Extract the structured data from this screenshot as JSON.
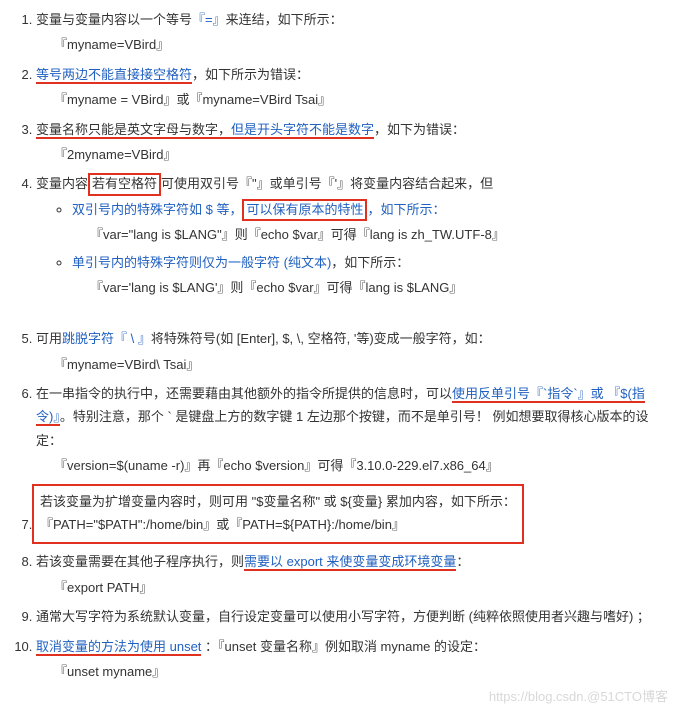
{
  "items": {
    "i1": {
      "pre": "变量与变量内容以一个等号",
      "eq": "『=』",
      "post": "来连结，如下所示：",
      "code": "『myname=VBird』"
    },
    "i2": {
      "head": "等号两边不能直接接空格符",
      "post": "，如下所示为错误：",
      "code": "『myname = VBird』或『myname=VBird Tsai』"
    },
    "i3": {
      "pre": "变量名称只能是英文字母与数字，",
      "mid": "但是开头字符不能是数字",
      "post": "，如下为错误：",
      "code": "『2myname=VBird』"
    },
    "i4": {
      "pre": "变量内容",
      "box1": "若有空格符",
      "mid": "可使用双引号『\"』或单引号『'』将变量内容结合起来，但",
      "s1a": "双引号内的特殊字符如 $ 等，",
      "s1box": "可以保有原本的特性",
      "s1post": "，如下所示：",
      "s1code": "『var=\"lang is $LANG\"』则『echo $var』可得『lang is zh_TW.UTF-8』",
      "s2a": "单引号内的特殊字符则仅为一般字符 (纯文本)",
      "s2post": "，如下所示：",
      "s2code": "『var='lang is $LANG'』则『echo $var』可得『lang is $LANG』"
    },
    "i5": {
      "pre": "可用",
      "blue": "跳脱字符『 \\ 』",
      "post": "将特殊符号(如 [Enter], $, \\, 空格符, '等)变成一般字符，如：",
      "code": "『myname=VBird\\ Tsai』"
    },
    "i6": {
      "pre": "在一串指令的执行中，还需要藉由其他额外的指令所提供的信息时，可以",
      "blue": "使用反单引号『`指令`』或 『$(指令)』",
      "post": "。特别注意，那个 ` 是键盘上方的数字键 1 左边那个按键，而不是单引号！ 例如想要取得核心版本的设定：",
      "code": "『version=$(uname -r)』再『echo $version』可得『3.10.0-229.el7.x86_64』"
    },
    "i7": {
      "line1": "若该变量为扩增变量内容时，则可用 \"$变量名称\" 或 ${变量} 累加内容，如下所示：",
      "line2": "『PATH=\"$PATH\":/home/bin』或『PATH=${PATH}:/home/bin』"
    },
    "i8": {
      "pre": "若该变量需要在其他子程序执行，则",
      "blue": "需要以 export 来使变量变成环境变量",
      "post": "：",
      "code": "『export PATH』"
    },
    "i9": {
      "text": "通常大写字符为系统默认变量，自行设定变量可以使用小写字符，方便判断 (纯粹依照使用者兴趣与嗜好) ；"
    },
    "i10": {
      "blue": "取消变量的方法为使用 unset",
      "post": " ：『unset 变量名称』例如取消 myname 的设定：",
      "code": "『unset myname』"
    }
  },
  "watermark": "https://blog.csdn.@51CTO博客"
}
